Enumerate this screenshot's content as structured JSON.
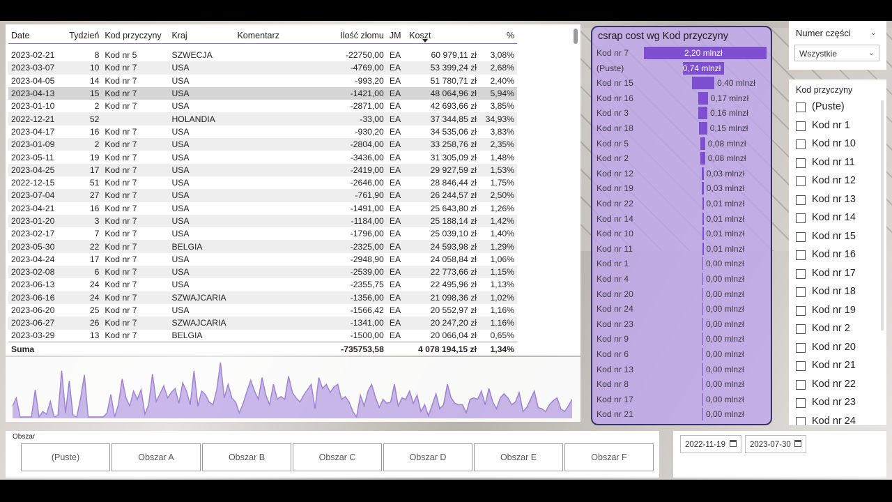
{
  "table": {
    "headers": [
      "Date",
      "Tydzień",
      "Kod przyczyny",
      "Kraj",
      "Komentarz",
      "Ilość złomu",
      "JM",
      "Koszt",
      "%"
    ],
    "rows": [
      [
        "2023-02-21",
        "8",
        "Kod nr 5",
        "SZWECJA",
        "",
        "-22750,00",
        "EA",
        "60 979,11 zł",
        "3,08%"
      ],
      [
        "2023-03-07",
        "10",
        "Kod nr 7",
        "USA",
        "",
        "-4769,00",
        "EA",
        "53 399,24 zł",
        "2,68%"
      ],
      [
        "2023-04-05",
        "14",
        "Kod nr 7",
        "USA",
        "",
        "-993,20",
        "EA",
        "51 780,71 zł",
        "2,40%"
      ],
      [
        "2023-04-13",
        "15",
        "Kod nr 7",
        "USA",
        "",
        "-1421,00",
        "EA",
        "48 064,96 zł",
        "5,94%"
      ],
      [
        "2023-01-10",
        "2",
        "Kod nr 7",
        "USA",
        "",
        "-2871,00",
        "EA",
        "42 693,66 zł",
        "3,85%"
      ],
      [
        "2022-12-21",
        "52",
        "",
        "HOLANDIA",
        "",
        "-33,00",
        "EA",
        "37 344,85 zł",
        "34,93%"
      ],
      [
        "2023-04-17",
        "16",
        "Kod nr 7",
        "USA",
        "",
        "-930,20",
        "EA",
        "34 535,06 zł",
        "3,83%"
      ],
      [
        "2023-01-09",
        "2",
        "Kod nr 7",
        "USA",
        "",
        "-2804,00",
        "EA",
        "33 258,76 zł",
        "2,35%"
      ],
      [
        "2023-05-11",
        "19",
        "Kod nr 7",
        "USA",
        "",
        "-3436,00",
        "EA",
        "31 305,09 zł",
        "1,48%"
      ],
      [
        "2023-04-25",
        "17",
        "Kod nr 7",
        "USA",
        "",
        "-2419,00",
        "EA",
        "29 927,59 zł",
        "1,53%"
      ],
      [
        "2022-12-15",
        "51",
        "Kod nr 7",
        "USA",
        "",
        "-2646,00",
        "EA",
        "28 846,44 zł",
        "1,75%"
      ],
      [
        "2023-07-04",
        "27",
        "Kod nr 7",
        "USA",
        "",
        "-761,90",
        "EA",
        "26 244,57 zł",
        "2,50%"
      ],
      [
        "2023-04-21",
        "16",
        "Kod nr 7",
        "USA",
        "",
        "-1491,00",
        "EA",
        "25 643,80 zł",
        "1,26%"
      ],
      [
        "2023-01-20",
        "3",
        "Kod nr 7",
        "USA",
        "",
        "-1184,00",
        "EA",
        "25 188,14 zł",
        "1,42%"
      ],
      [
        "2023-02-17",
        "7",
        "Kod nr 7",
        "USA",
        "",
        "-1796,00",
        "EA",
        "25 039,10 zł",
        "1,40%"
      ],
      [
        "2023-05-30",
        "22",
        "Kod nr 7",
        "BELGIA",
        "",
        "-2325,00",
        "EA",
        "24 593,98 zł",
        "1,29%"
      ],
      [
        "2023-04-24",
        "17",
        "Kod nr 7",
        "USA",
        "",
        "-2948,90",
        "EA",
        "24 058,84 zł",
        "1,06%"
      ],
      [
        "2023-02-08",
        "6",
        "Kod nr 7",
        "USA",
        "",
        "-2539,00",
        "EA",
        "22 773,66 zł",
        "1,15%"
      ],
      [
        "2023-06-13",
        "24",
        "Kod nr 7",
        "USA",
        "",
        "-2355,75",
        "EA",
        "22 495,96 zł",
        "1,13%"
      ],
      [
        "2023-06-16",
        "24",
        "Kod nr 7",
        "SZWAJCARIA",
        "",
        "-1356,00",
        "EA",
        "21 098,36 zł",
        "1,02%"
      ],
      [
        "2023-06-20",
        "25",
        "Kod nr 7",
        "USA",
        "",
        "-1566,42",
        "EA",
        "20 552,97 zł",
        "1,16%"
      ],
      [
        "2023-06-27",
        "26",
        "Kod nr 7",
        "SZWAJCARIA",
        "",
        "-1341,00",
        "EA",
        "20 247,20 zł",
        "1,16%"
      ],
      [
        "2023-03-29",
        "13",
        "Kod nr 7",
        "BELGIA",
        "",
        "-1500,00",
        "EA",
        "20 066,04 zł",
        "0,65%"
      ]
    ],
    "total": [
      "Suma",
      "",
      "",
      "",
      "",
      "-735753,58",
      "",
      "4 078 194,15 zł",
      "1,34%"
    ]
  },
  "chart_data": [
    {
      "type": "bar",
      "title": "csrap cost wg Kod przyczyny",
      "categories": [
        "Kod nr 7",
        "(Puste)",
        "Kod nr 15",
        "Kod nr 16",
        "Kod nr 3",
        "Kod nr 18",
        "Kod nr 5",
        "Kod nr 2",
        "Kod nr 12",
        "Kod nr 19",
        "Kod nr 22",
        "Kod nr 14",
        "Kod nr 10",
        "Kod nr 11",
        "Kod nr 1",
        "Kod nr 4",
        "Kod nr 20",
        "Kod nr 24",
        "Kod nr 23",
        "Kod nr 9",
        "Kod nr 6",
        "Kod nr 13",
        "Kod nr 8",
        "Kod nr 17",
        "Kod nr 21"
      ],
      "values": [
        2.2,
        0.74,
        0.4,
        0.17,
        0.16,
        0.15,
        0.08,
        0.08,
        0.03,
        0.03,
        0.01,
        0.01,
        0.01,
        0.01,
        0.0,
        0.0,
        0.0,
        0.0,
        0.0,
        0.0,
        0.0,
        0.0,
        0.0,
        0.0,
        0.0
      ],
      "labels": [
        "2,20 mlnzł",
        "0,74 mlnzł",
        "0,40 mlnzł",
        "0,17 mlnzł",
        "0,16 mlnzł",
        "0,15 mlnzł",
        "0,08 mlnzł",
        "0,08 mlnzł",
        "0,03 mlnzł",
        "0,03 mlnzł",
        "0,01 mlnzł",
        "0,01 mlnzł",
        "0,01 mlnzł",
        "0,01 mlnzł",
        "0,00 mlnzł",
        "0,00 mlnzł",
        "0,00 mlnzł",
        "0,00 mlnzł",
        "0,00 mlnzł",
        "0,00 mlnzł",
        "0,00 mlnzł",
        "0,00 mlnzł",
        "0,00 mlnzł",
        "0,00 mlnzł",
        "0,00 mlnzł"
      ],
      "color": "#7f4fd1"
    },
    {
      "type": "area",
      "values": [
        18,
        30,
        2,
        2,
        2,
        2,
        42,
        2,
        10,
        6,
        25,
        2,
        4,
        70,
        8,
        55,
        4,
        2,
        30,
        64,
        2,
        2,
        2,
        2,
        2,
        8,
        35,
        2,
        20,
        58,
        30,
        18,
        40,
        28,
        42,
        6,
        20,
        65,
        25,
        36,
        48,
        30,
        38,
        44,
        22,
        52,
        40,
        20,
        70,
        18,
        40,
        35,
        24,
        20,
        42,
        82,
        30,
        50,
        30,
        24,
        8,
        22,
        40,
        56,
        40,
        28,
        60,
        34,
        20,
        50,
        28,
        32,
        28,
        62,
        38,
        30,
        24,
        34,
        42,
        50,
        14,
        60,
        44,
        50,
        38,
        46,
        50,
        28,
        32,
        24,
        10,
        2,
        34,
        18,
        40,
        50,
        30,
        16,
        28,
        22,
        24,
        50,
        18,
        30,
        28,
        40,
        22,
        34,
        10,
        20,
        4,
        20,
        36,
        14,
        20,
        50,
        30,
        22,
        20,
        20,
        8,
        28,
        30,
        28,
        40,
        20,
        44,
        24,
        14,
        30,
        36,
        30,
        20,
        24,
        38,
        10,
        16,
        28,
        40,
        16,
        14,
        10,
        20,
        26,
        30,
        14,
        10,
        18,
        28
      ],
      "color": "#9a7dd6"
    }
  ],
  "slicers": {
    "numer_czesci": {
      "title": "Numer części",
      "selected": "Wszystkie"
    },
    "kod_przyczyny": {
      "title": "Kod przyczyny",
      "items": [
        "(Puste)",
        "Kod nr 1",
        "Kod nr 10",
        "Kod nr 11",
        "Kod nr 12",
        "Kod nr 13",
        "Kod nr 14",
        "Kod nr 15",
        "Kod nr 16",
        "Kod nr 17",
        "Kod nr 18",
        "Kod nr 19",
        "Kod nr 2",
        "Kod nr 20",
        "Kod nr 21",
        "Kod nr 22",
        "Kod nr 23",
        "Kod nr 24"
      ]
    },
    "obszar": {
      "title": "Obszar",
      "items": [
        "(Puste)",
        "Obszar A",
        "Obszar B",
        "Obszar C",
        "Obszar D",
        "Obszar E",
        "Obszar F"
      ]
    },
    "date": {
      "start": "2022-11-19",
      "end": "2023-07-30"
    }
  }
}
